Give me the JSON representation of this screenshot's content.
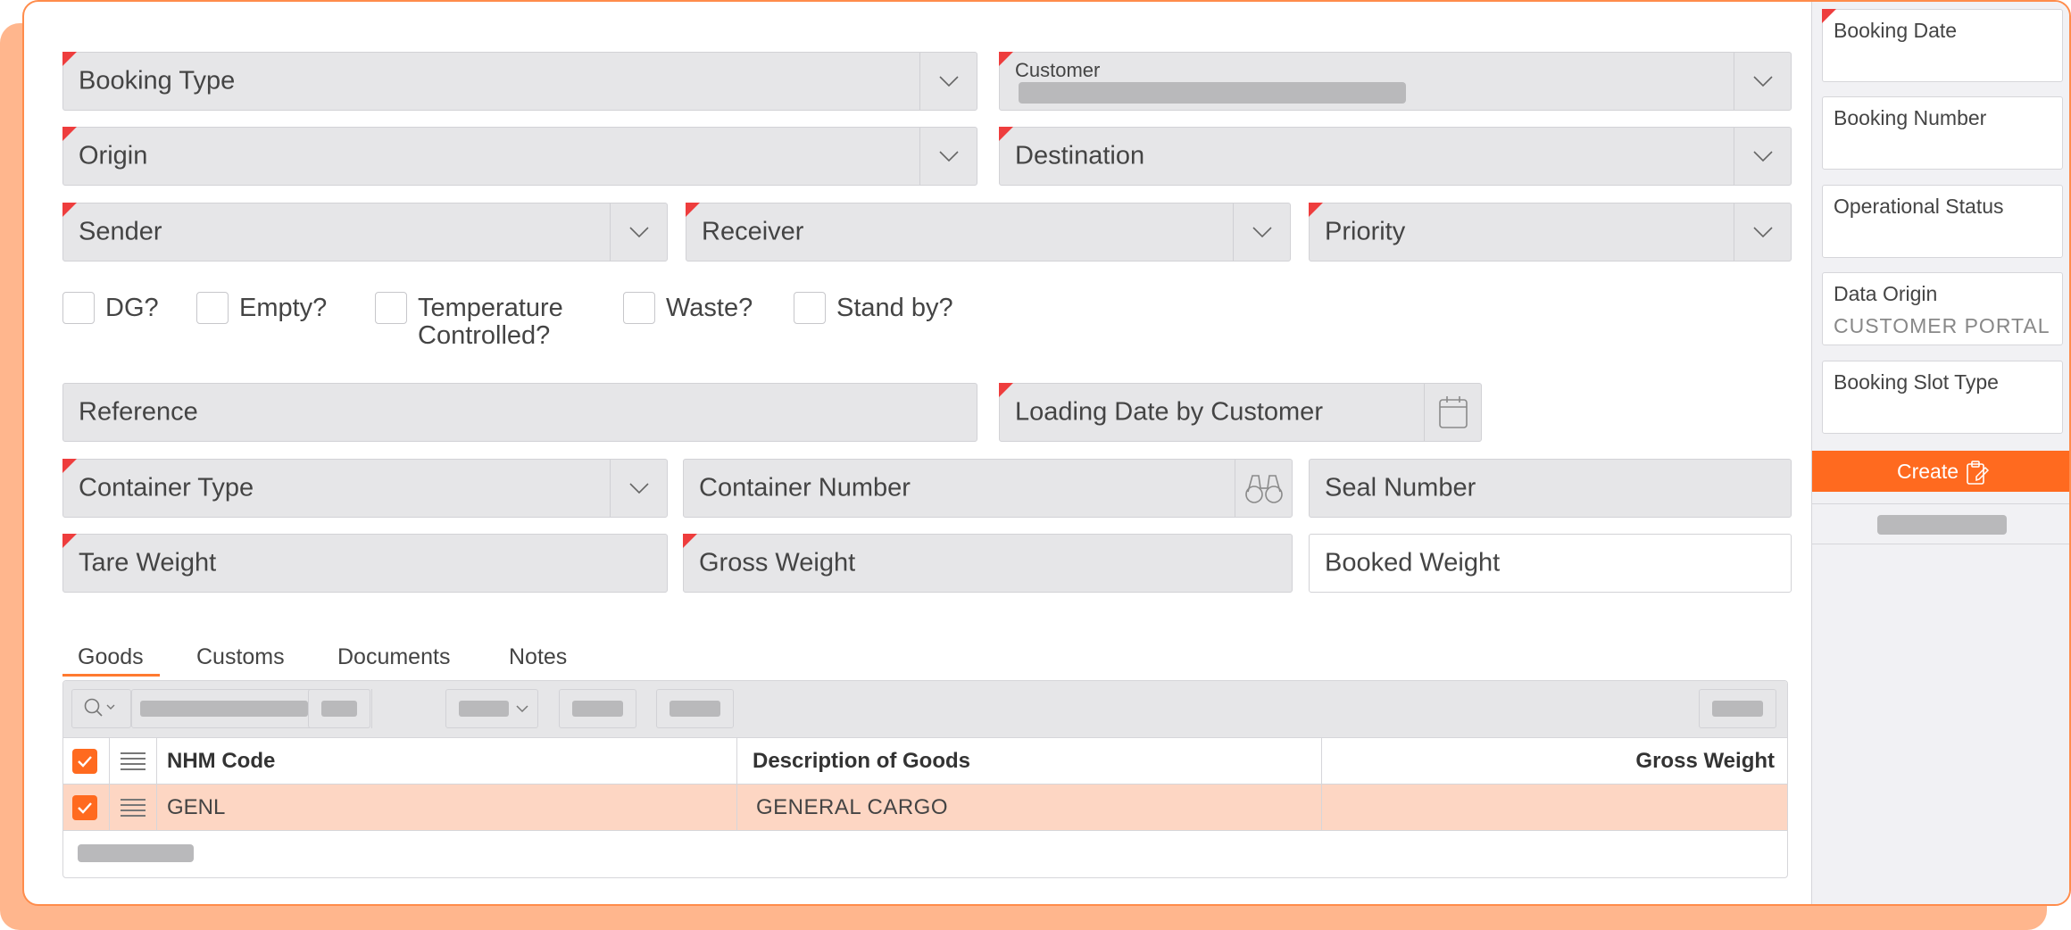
{
  "form": {
    "booking_type": "Booking Type",
    "customer_label": "Customer",
    "origin": "Origin",
    "destination": "Destination",
    "sender": "Sender",
    "receiver": "Receiver",
    "priority": "Priority",
    "checkboxes": {
      "dg": "DG?",
      "empty": "Empty?",
      "temp_line1": "Temperature",
      "temp_line2": "Controlled?",
      "waste": "Waste?",
      "standby": "Stand by?"
    },
    "reference": "Reference",
    "loading_date": "Loading Date by Customer",
    "container_type": "Container Type",
    "container_number": "Container Number",
    "seal_number": "Seal Number",
    "tare_weight": "Tare Weight",
    "gross_weight": "Gross Weight",
    "booked_weight": "Booked Weight"
  },
  "tabs": [
    "Goods",
    "Customs",
    "Documents",
    "Notes"
  ],
  "grid": {
    "columns": [
      "NHM Code",
      "Description of Goods",
      "Gross Weight"
    ],
    "rows": [
      {
        "nhm_code": "GENL",
        "description": "GENERAL CARGO",
        "gross_weight": ""
      }
    ]
  },
  "sidebar": {
    "booking_date": "Booking Date",
    "booking_number": "Booking Number",
    "operational_status": "Operational Status",
    "data_origin_label": "Data Origin",
    "data_origin_value": "CUSTOMER PORTAL",
    "booking_slot_type": "Booking Slot Type",
    "create_label": "Create"
  },
  "colors": {
    "accent": "#ff6a1f",
    "required_marker": "#ee3d3d",
    "field_bg": "#e6e6e8",
    "selected_row": "#fdd6c3"
  }
}
